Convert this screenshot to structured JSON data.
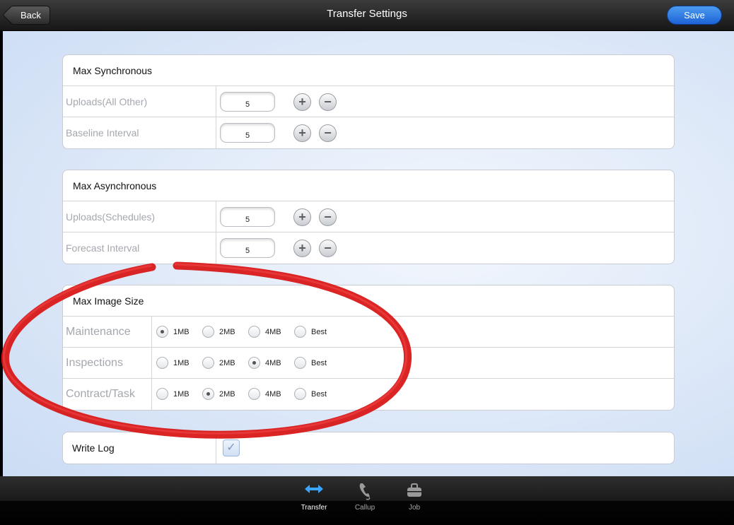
{
  "header": {
    "title": "Transfer Settings",
    "back_label": "Back",
    "save_label": "Save"
  },
  "sync": {
    "title": "Max Synchronous",
    "rows": [
      {
        "label": "Uploads(All Other)",
        "value": "5"
      },
      {
        "label": "Baseline Interval",
        "value": "5"
      }
    ]
  },
  "async": {
    "title": "Max Asynchronous",
    "rows": [
      {
        "label": "Uploads(Schedules)",
        "value": "5"
      },
      {
        "label": "Forecast Interval",
        "value": "5"
      }
    ]
  },
  "image_size": {
    "title": "Max Image Size",
    "options": [
      "1MB",
      "2MB",
      "4MB",
      "Best"
    ],
    "rows": [
      {
        "label": "Maintenance",
        "selected": "1MB"
      },
      {
        "label": "Inspections",
        "selected": "4MB"
      },
      {
        "label": "Contract/Task",
        "selected": "2MB"
      }
    ]
  },
  "write_log": {
    "label": "Write Log",
    "checked": true
  },
  "stepper": {
    "plus": "+",
    "minus": "−"
  },
  "tabbar": {
    "tabs": [
      {
        "label": "Transfer",
        "icon": "arrows-horizontal-icon",
        "active": true
      },
      {
        "label": "Callup",
        "icon": "phone-icon",
        "active": false
      },
      {
        "label": "Job",
        "icon": "briefcase-icon",
        "active": false
      }
    ]
  },
  "colors": {
    "accent": "#1d63d6",
    "annotation": "#e01818",
    "active_tab_icon": "#3aa6ff"
  }
}
